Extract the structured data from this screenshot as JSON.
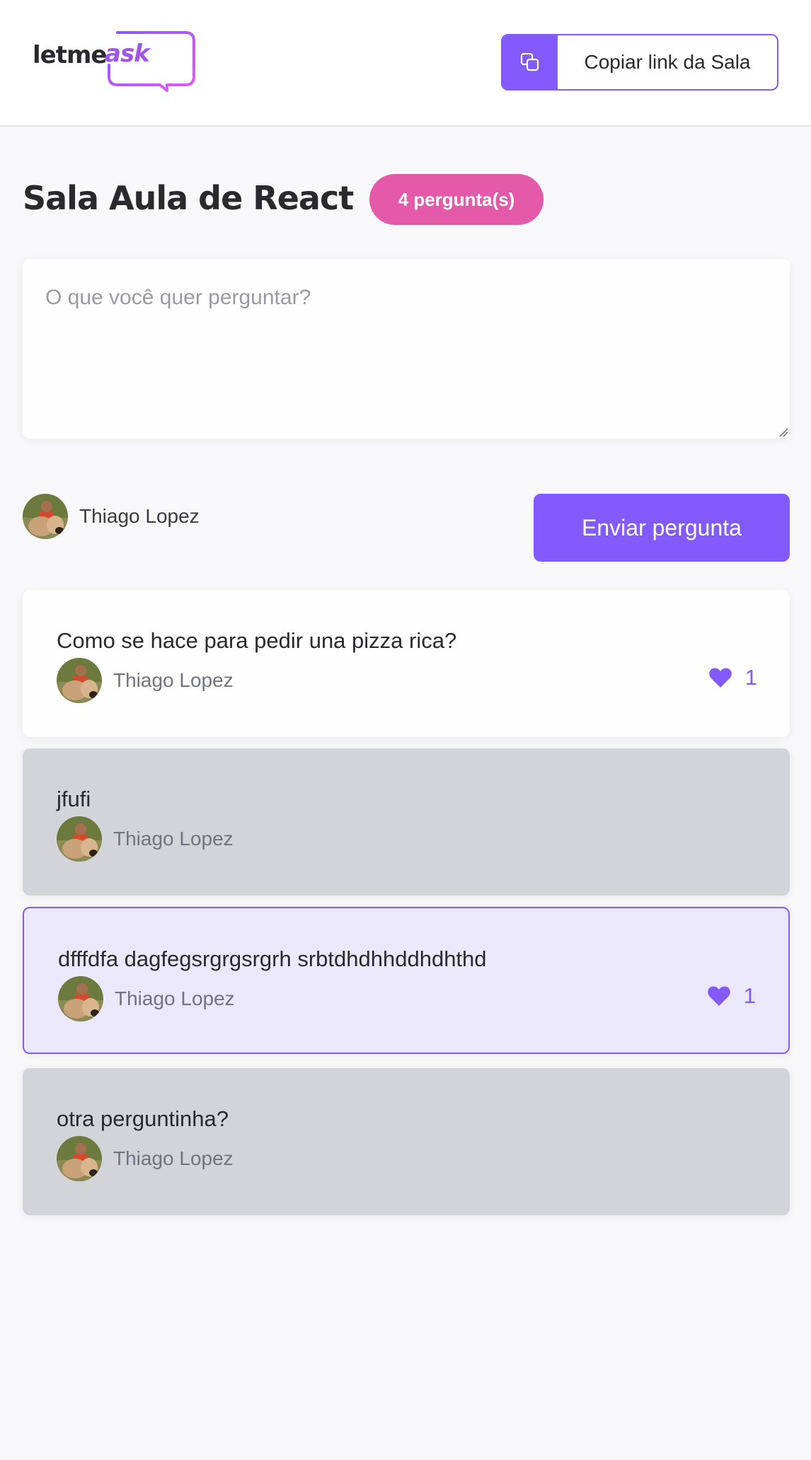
{
  "header": {
    "logo": {
      "part1": "letme",
      "part2": "ask"
    },
    "copy_button_label": "Copiar link da Sala",
    "copy_icon": "copy-icon"
  },
  "room": {
    "title": "Sala Aula de React",
    "badge": "4 pergunta(s)"
  },
  "form": {
    "placeholder": "O que você quer perguntar?",
    "value": "",
    "user_name": "Thiago Lopez",
    "submit_label": "Enviar pergunta"
  },
  "questions": [
    {
      "content": "Como se hace para pedir una pizza rica?",
      "author": "Thiago Lopez",
      "state": "default",
      "likes": "1"
    },
    {
      "content": "jfufi",
      "author": "Thiago Lopez",
      "state": "answered",
      "likes": ""
    },
    {
      "content": "dfffdfa dagfegsrgrgsrgrh srbtdhdhhddhdhthd",
      "author": "Thiago Lopez",
      "state": "highlighted",
      "likes": "1"
    },
    {
      "content": "otra perguntinha?",
      "author": "Thiago Lopez",
      "state": "answered",
      "likes": ""
    }
  ],
  "colors": {
    "primary": "#835afd",
    "badge": "#e559a9",
    "answered_bg": "#d3d4d9",
    "highlighted_bg": "#ece8fc",
    "background": "#f8f8fa"
  }
}
